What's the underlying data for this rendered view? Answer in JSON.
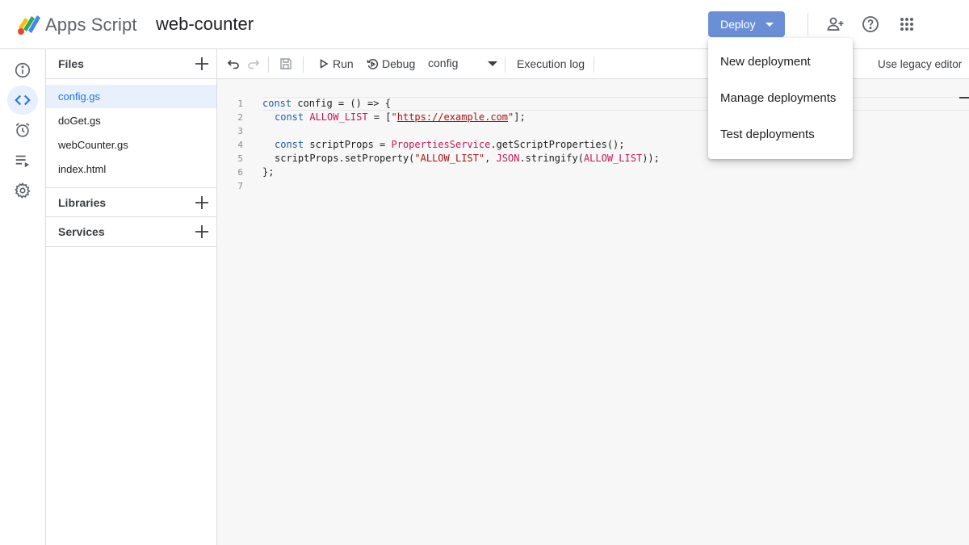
{
  "header": {
    "app_name": "Apps Script",
    "project_name": "web-counter",
    "deploy_label": "Deploy",
    "icons": [
      "add-collaborator-icon",
      "help-icon",
      "apps-grid-icon"
    ]
  },
  "rail": {
    "items": [
      {
        "name": "overview",
        "icon": "info-icon"
      },
      {
        "name": "editor",
        "icon": "code-icon",
        "active": true
      },
      {
        "name": "triggers",
        "icon": "alarm-icon"
      },
      {
        "name": "executions",
        "icon": "executions-list-icon"
      },
      {
        "name": "settings",
        "icon": "gear-icon"
      }
    ]
  },
  "files_panel": {
    "files_title": "Files",
    "files": [
      "config.gs",
      "doGet.gs",
      "webCounter.gs",
      "index.html"
    ],
    "active_file": "config.gs",
    "libraries_title": "Libraries",
    "services_title": "Services"
  },
  "toolbar": {
    "run_label": "Run",
    "debug_label": "Debug",
    "function_select": "config",
    "execution_log_label": "Execution log",
    "legacy_label": "Use legacy editor"
  },
  "editor": {
    "line_numbers": [
      "1",
      "2",
      "3",
      "4",
      "5",
      "6",
      "7"
    ],
    "code": {
      "l1_kw": "const",
      "l1_rest": " config = () => {",
      "l2_kw": "const",
      "l2_const": "ALLOW_LIST",
      "l2_mid": " = [",
      "l2_q1": "\"",
      "l2_url": "https://example.com",
      "l2_q2": "\"",
      "l2_end": "];",
      "l4_kw": "const",
      "l4_mid": " scriptProps = ",
      "l4_const": "PropertiesService",
      "l4_end": ".getScriptProperties();",
      "l5_start": "scriptProps.setProperty(",
      "l5_str": "\"ALLOW_LIST\"",
      "l5_comma": ", ",
      "l5_json": "JSON",
      "l5_mid": ".stringify(",
      "l5_const": "ALLOW_LIST",
      "l5_end": "));",
      "l6": "};"
    }
  },
  "deploy_menu": {
    "items": [
      "New deployment",
      "Manage deployments",
      "Test deployments"
    ]
  },
  "colors": {
    "accent": "#1a73e8",
    "deploy_button": "#6b8fd6",
    "keyword": "#1f5bb0",
    "constant": "#c2185b",
    "string": "#a31515"
  }
}
